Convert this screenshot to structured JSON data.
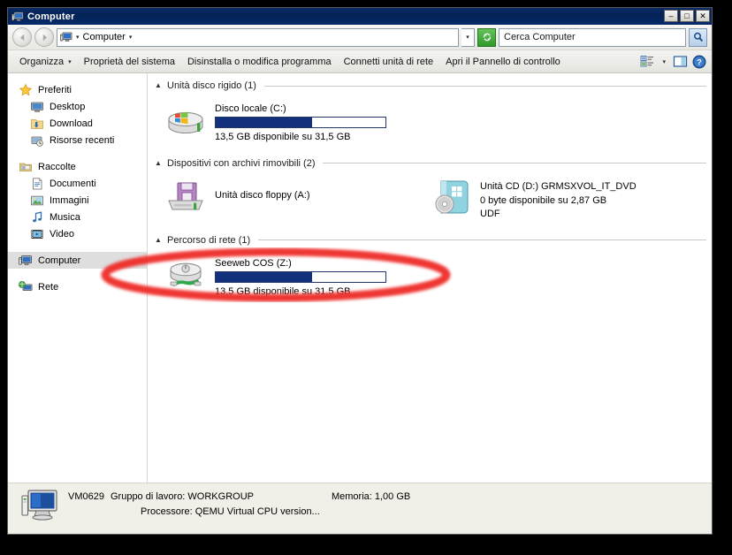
{
  "window": {
    "title": "Computer",
    "title_icon": "computer-icon",
    "minimize_label": "–",
    "maximize_label": "□",
    "close_label": "✕"
  },
  "address_bar": {
    "back_label": "←",
    "forward_label": "→",
    "crumb": "Computer",
    "caret": "▾",
    "dropdown_caret": "▾",
    "refresh_label": "↻",
    "search_placeholder": "Cerca Computer",
    "search_value": "Cerca Computer",
    "search_button_label": "⚲"
  },
  "toolbar": {
    "items": [
      {
        "label": "Organizza",
        "has_caret": true
      },
      {
        "label": "Proprietà del sistema",
        "has_caret": false
      },
      {
        "label": "Disinstalla o modifica programma",
        "has_caret": false
      },
      {
        "label": "Connetti unità di rete",
        "has_caret": false
      },
      {
        "label": "Apri il Pannello di controllo",
        "has_caret": false
      }
    ],
    "caret": "▾",
    "views_icon": "views-icon",
    "views_caret": "▾",
    "preview_icon": "preview-pane-icon",
    "help_icon": "help-icon"
  },
  "sidebar": {
    "groups": [
      {
        "header": {
          "label": "Preferiti",
          "icon": "star-icon"
        },
        "items": [
          {
            "label": "Desktop",
            "icon": "desktop-icon"
          },
          {
            "label": "Download",
            "icon": "download-folder-icon"
          },
          {
            "label": "Risorse recenti",
            "icon": "recent-places-icon"
          }
        ]
      },
      {
        "header": {
          "label": "Raccolte",
          "icon": "libraries-icon"
        },
        "items": [
          {
            "label": "Documenti",
            "icon": "documents-icon"
          },
          {
            "label": "Immagini",
            "icon": "pictures-icon"
          },
          {
            "label": "Musica",
            "icon": "music-icon"
          },
          {
            "label": "Video",
            "icon": "video-icon"
          }
        ]
      },
      {
        "header": {
          "label": "Computer",
          "icon": "computer-icon",
          "selected": true
        },
        "items": []
      },
      {
        "header": {
          "label": "Rete",
          "icon": "network-icon"
        },
        "items": []
      }
    ]
  },
  "content": {
    "groups": [
      {
        "title": "Unità disco rigido (1)",
        "collapse_glyph": "▲",
        "items": [
          {
            "icon": "hard-disk-icon",
            "name": "Disco locale (C:)",
            "has_bar": true,
            "used_percent": 57,
            "sub1": "13,5 GB disponibile su 31,5 GB",
            "sub2": ""
          }
        ]
      },
      {
        "title": "Dispositivi con archivi rimovibili (2)",
        "collapse_glyph": "▲",
        "items": [
          {
            "icon": "floppy-drive-icon",
            "name": "Unità disco floppy (A:)",
            "has_bar": false,
            "used_percent": 0,
            "sub1": "",
            "sub2": ""
          },
          {
            "icon": "cd-drive-icon",
            "name": "Unità CD (D:) GRMSXVOL_IT_DVD",
            "has_bar": false,
            "used_percent": 100,
            "sub1": "0 byte disponibile su 2,87 GB",
            "sub2": "UDF"
          }
        ]
      },
      {
        "title": "Percorso di rete (1)",
        "collapse_glyph": "▲",
        "items": [
          {
            "icon": "network-drive-icon",
            "name": "Seeweb COS (Z:)",
            "has_bar": true,
            "used_percent": 57,
            "sub1": "13,5 GB disponibile su 31,5 GB",
            "sub2": ""
          }
        ]
      }
    ]
  },
  "status_bar": {
    "icon": "computer-large-icon",
    "computer_name": "VM0629",
    "workgroup_label": "Gruppo di lavoro: WORKGROUP",
    "memory_label": "Memoria: 1,00 GB",
    "processor_label": "Processore: QEMU Virtual CPU version..."
  },
  "annotation": {
    "shape": "ellipse",
    "color": "#ee2f2a",
    "target": "Seeweb COS (Z:)"
  },
  "colors": {
    "titlebar": "#042256",
    "usage_bar_fill": "#12307c",
    "selection": "#dedede",
    "annotation_red": "#ee2f2a"
  }
}
